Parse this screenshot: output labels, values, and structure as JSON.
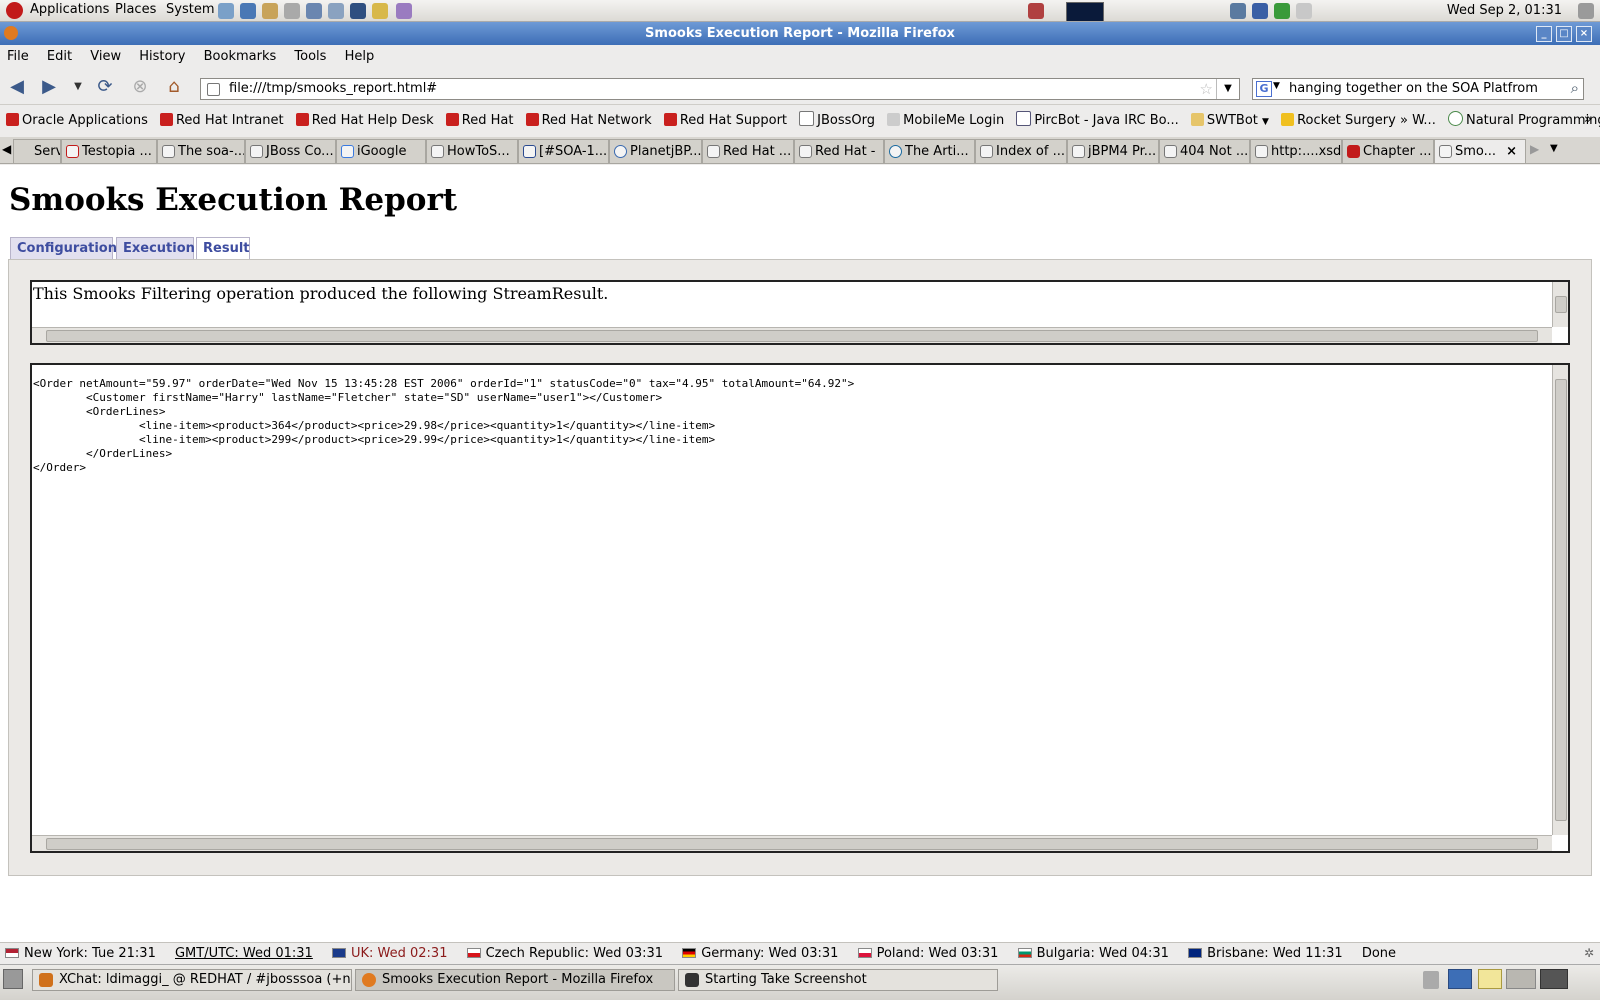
{
  "panel": {
    "menus": [
      "Applications",
      "Places",
      "System"
    ],
    "clock": "Wed Sep  2, 01:31"
  },
  "window": {
    "title": "Smooks Execution Report - Mozilla Firefox"
  },
  "menubar": {
    "items": [
      "File",
      "Edit",
      "View",
      "History",
      "Bookmarks",
      "Tools",
      "Help"
    ]
  },
  "navbar": {
    "url": "file:///tmp/smooks_report.html#",
    "search_value": "hanging together on the SOA Platfrom"
  },
  "bookmarks": [
    "Oracle Applications",
    "Red Hat Intranet",
    "Red Hat Help Desk",
    "Red Hat",
    "Red Hat Network",
    "Red Hat Support",
    "JBossOrg",
    "MobileMe Login",
    "PircBot - Java IRC Bo...",
    "SWTBot",
    "Rocket Surgery » W...",
    "Natural Programming"
  ],
  "tabs": [
    "Serv...",
    "Testopia ...",
    "The soa-...",
    "JBoss Co...",
    "iGoogle",
    "HowToS...",
    "[#SOA-1...",
    "PlanetjBP...",
    "Red Hat ...",
    "Red Hat -",
    "The Arti...",
    "Index of ...",
    "jBPM4 Pr...",
    "404 Not ...",
    "http:....xsd",
    "Chapter ...",
    "Smo..."
  ],
  "page": {
    "title": "Smooks Execution Report",
    "tabs": [
      "Configuration",
      "Execution",
      "Result"
    ],
    "active_tab": "Result",
    "message": "This Smooks Filtering operation produced the following StreamResult.",
    "xml": "<Order netAmount=\"59.97\" orderDate=\"Wed Nov 15 13:45:28 EST 2006\" orderId=\"1\" statusCode=\"0\" tax=\"4.95\" totalAmount=\"64.92\">\n        <Customer firstName=\"Harry\" lastName=\"Fletcher\" state=\"SD\" userName=\"user1\"></Customer>\n        <OrderLines>\n                <line-item><product>364</product><price>29.98</price><quantity>1</quantity></line-item>\n                <line-item><product>299</product><price>29.99</price><quantity>1</quantity></line-item>\n        </OrderLines>\n</Order>"
  },
  "statusbar": {
    "clocks": [
      {
        "label": "New York: Tue 21:31"
      },
      {
        "label": "GMT/UTC: Wed 01:31"
      },
      {
        "label": "UK: Wed 02:31"
      },
      {
        "label": "Czech Republic: Wed 03:31"
      },
      {
        "label": "Germany: Wed 03:31"
      },
      {
        "label": "Poland: Wed 03:31"
      },
      {
        "label": "Bulgaria: Wed 04:31"
      },
      {
        "label": "Brisbane: Wed 11:31"
      }
    ],
    "status": "Done"
  },
  "taskbar": {
    "tasks": [
      "XChat: ldimaggi_ @ REDHAT / #jbosssoa (+n)",
      "Smooks Execution Report - Mozilla Firefox",
      "Starting Take Screenshot"
    ]
  },
  "colors": {
    "titlebar": "#3d6eb6",
    "page_tab_text": "#3e4da0",
    "uk_clock": "#8b1a1a"
  }
}
